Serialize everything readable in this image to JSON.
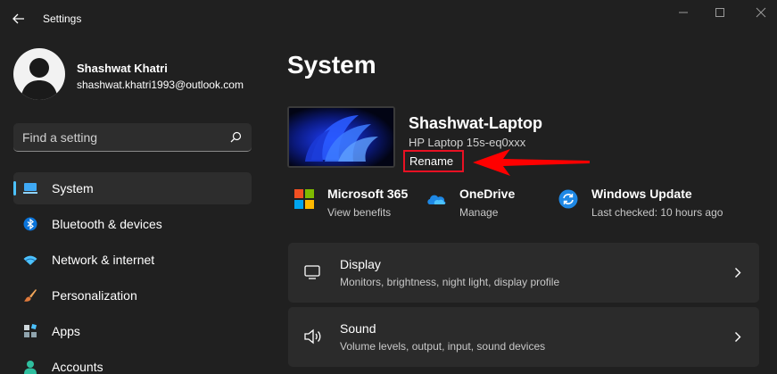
{
  "app": {
    "title": "Settings"
  },
  "profile": {
    "name": "Shashwat Khatri",
    "email": "shashwat.khatri1993@outlook.com"
  },
  "search": {
    "placeholder": "Find a setting"
  },
  "sidebar": {
    "items": [
      {
        "label": "System",
        "icon": "laptop-icon",
        "active": true
      },
      {
        "label": "Bluetooth & devices",
        "icon": "bluetooth-icon"
      },
      {
        "label": "Network & internet",
        "icon": "wifi-icon"
      },
      {
        "label": "Personalization",
        "icon": "brush-icon"
      },
      {
        "label": "Apps",
        "icon": "apps-icon"
      },
      {
        "label": "Accounts",
        "icon": "person-icon"
      }
    ]
  },
  "main": {
    "title": "System",
    "device": {
      "name": "Shashwat-Laptop",
      "model": "HP Laptop 15s-eq0xxx",
      "rename_label": "Rename"
    },
    "quick_links": [
      {
        "title": "Microsoft 365",
        "subtitle": "View benefits",
        "icon": "microsoft-logo-icon"
      },
      {
        "title": "OneDrive",
        "subtitle": "Manage",
        "icon": "cloud-icon"
      },
      {
        "title": "Windows Update",
        "subtitle": "Last checked: 10 hours ago",
        "icon": "sync-icon"
      }
    ],
    "cards": [
      {
        "title": "Display",
        "subtitle": "Monitors, brightness, night light, display profile",
        "icon": "monitor-icon"
      },
      {
        "title": "Sound",
        "subtitle": "Volume levels, output, input, sound devices",
        "icon": "speaker-icon"
      }
    ]
  },
  "colors": {
    "accent": "#4cc2ff",
    "annotation": "#e81123",
    "background": "#202020",
    "card": "#2b2b2b"
  }
}
